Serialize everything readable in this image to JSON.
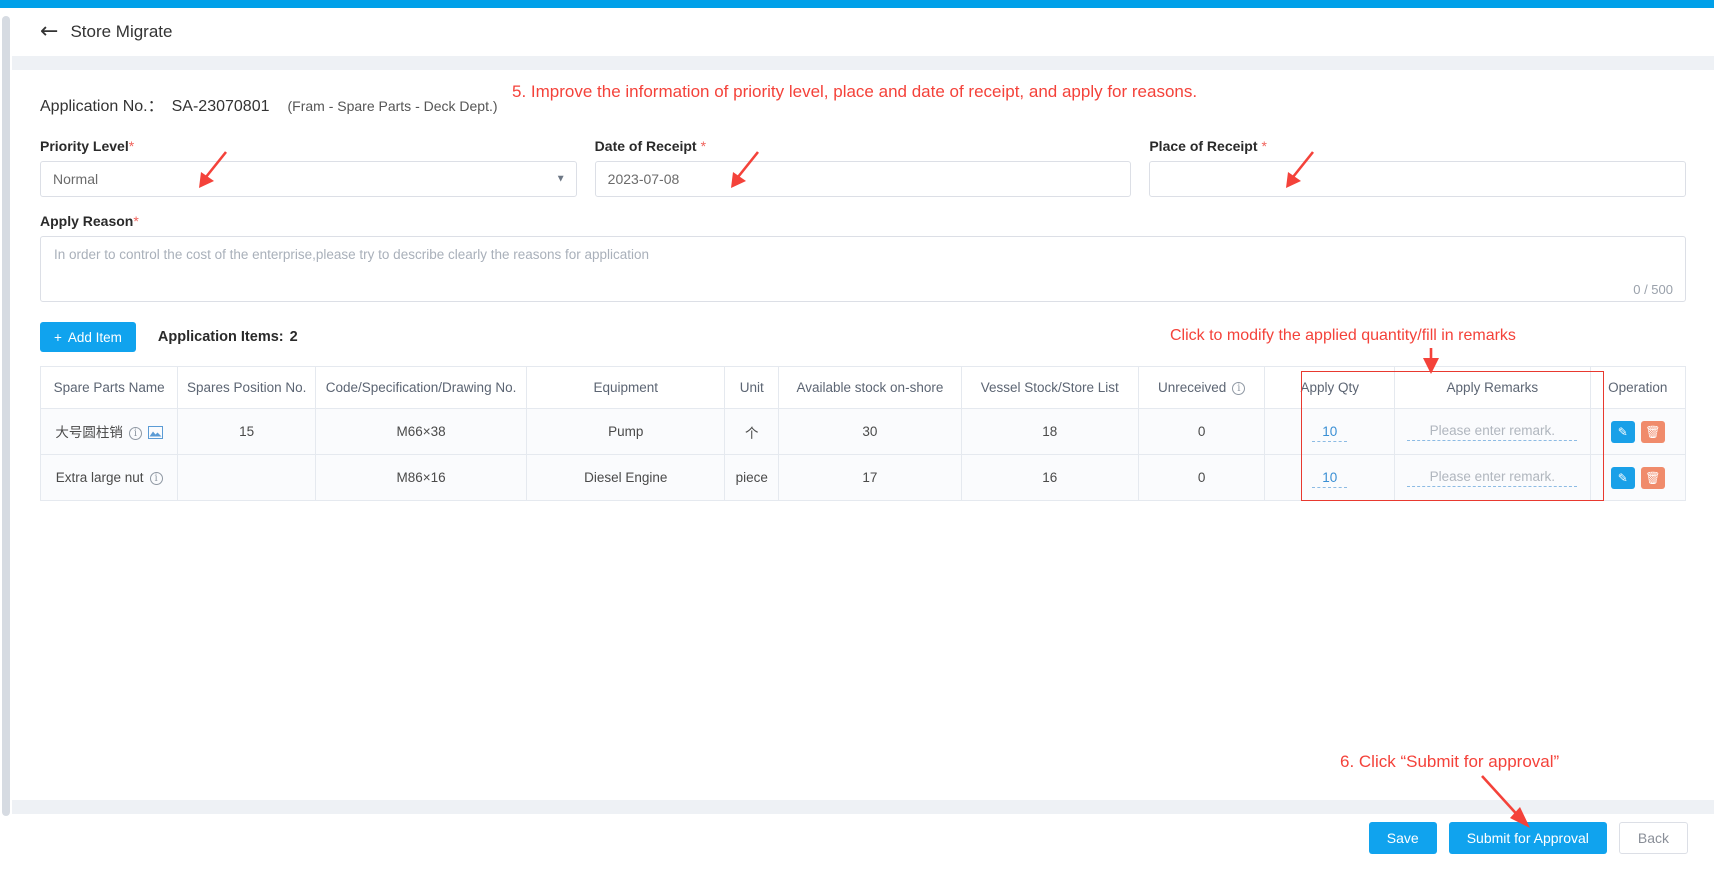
{
  "theme": {
    "accent": "#00a0e9",
    "button_blue": "#10a3ee",
    "annotation_red": "#f4423a",
    "required_red": "#f0625b",
    "delete_orange": "#f08b6b"
  },
  "header": {
    "back_icon": "back-arrow-icon",
    "title": "Store Migrate"
  },
  "application": {
    "label": "Application No.：",
    "number": "SA-23070801",
    "department": "(Fram - Spare Parts - Deck Dept.)"
  },
  "form": {
    "priority": {
      "label": "Priority Level",
      "required_mark": "*",
      "value": "Normal",
      "caret_icon": "chevron-down-icon"
    },
    "date_of_receipt": {
      "label": "Date of Receipt",
      "required_mark": "*",
      "value": "2023-07-08"
    },
    "place_of_receipt": {
      "label": "Place of Receipt",
      "required_mark": "*",
      "value": ""
    },
    "apply_reason": {
      "label": "Apply Reason",
      "required_mark": "*",
      "value": "",
      "placeholder": "In order to control the cost of the enterprise,please try to describe clearly the reasons for application",
      "char_count": "0 / 500"
    }
  },
  "items_toolbar": {
    "add_item_label": "Add  Item",
    "add_icon": "plus-icon",
    "count_label": "Application Items:",
    "count_value": "2"
  },
  "table": {
    "columns": [
      "Spare Parts Name",
      "Spares Position No.",
      "Code/Specification/Drawing No.",
      "Equipment",
      "Unit",
      "Available stock on-shore",
      "Vessel Stock/Store List",
      "Unreceived",
      "Apply Qty",
      "Apply Remarks",
      "Operation"
    ],
    "unreceived_info_icon": "info-icon",
    "rows": [
      {
        "name": "大号圆柱销",
        "name_info_icon": "info-icon",
        "name_image_icon": "image-icon",
        "has_image_icon": true,
        "position_no": "15",
        "code": "M66×38",
        "equipment": "Pump",
        "unit": "个",
        "available_stock": "30",
        "vessel_stock": "18",
        "unreceived": "0",
        "apply_qty": "10",
        "remark_placeholder": "Please enter remark.",
        "edit_icon": "pencil-icon",
        "delete_icon": "trash-icon"
      },
      {
        "name": "Extra large nut",
        "name_info_icon": "info-icon",
        "name_image_icon": "",
        "has_image_icon": false,
        "position_no": "",
        "code": "M86×16",
        "equipment": "Diesel Engine",
        "unit": "piece",
        "available_stock": "17",
        "vessel_stock": "16",
        "unreceived": "0",
        "apply_qty": "10",
        "remark_placeholder": "Please enter remark.",
        "edit_icon": "pencil-icon",
        "delete_icon": "trash-icon"
      }
    ]
  },
  "annotations": {
    "step5": "5. Improve the information of priority level, place and date of receipt, and apply for reasons.",
    "apply_cols": "Click to modify the applied quantity/fill in remarks",
    "step6": "6. Click  “Submit for approval”"
  },
  "footer": {
    "save_label": "Save",
    "submit_label": "Submit for Approval",
    "back_label": "Back"
  }
}
